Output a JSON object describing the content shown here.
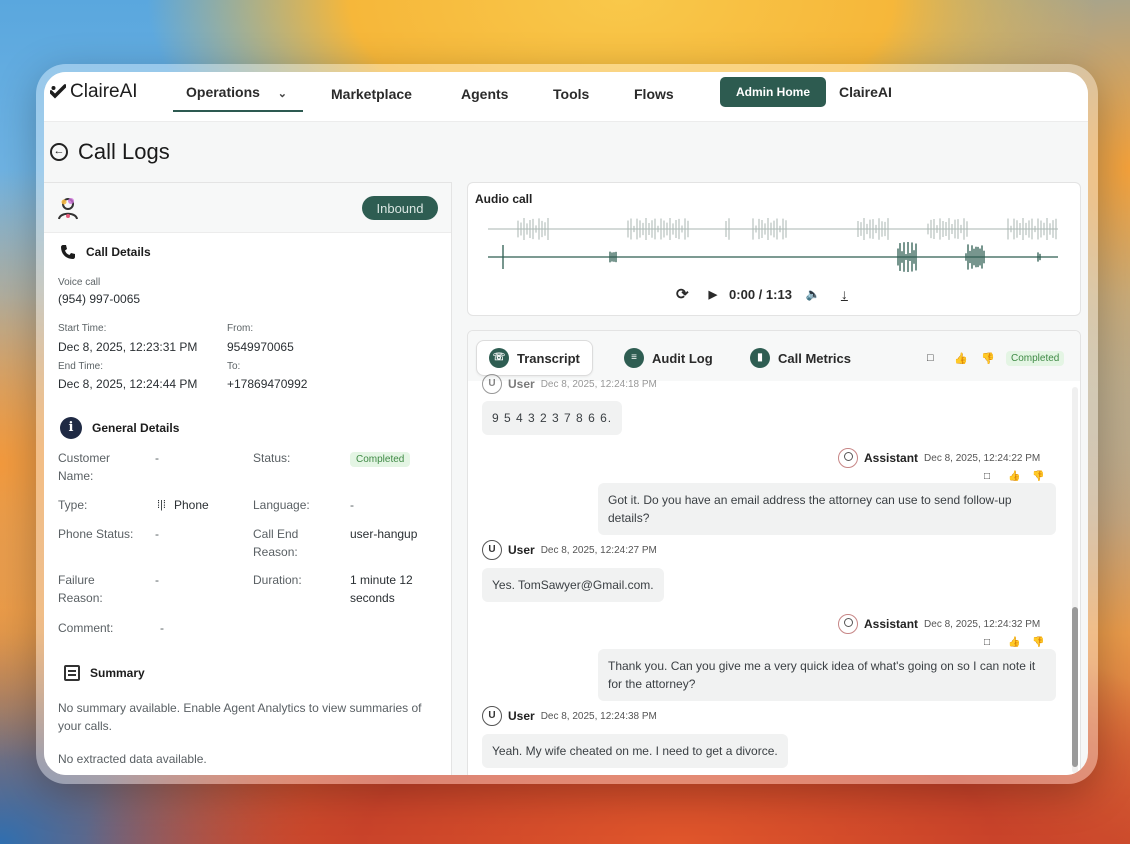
{
  "nav": {
    "logo": "ClaireAI",
    "operations": "Operations",
    "marketplace": "Marketplace",
    "agents": "Agents",
    "tools": "Tools",
    "flows": "Flows",
    "admin_home": "Admin Home",
    "account": "ClaireAI"
  },
  "page": {
    "title": "Call Logs"
  },
  "left": {
    "badge": "Inbound",
    "call_details": {
      "title": "Call Details",
      "call_type": "Voice call",
      "phone": "(954) 997-0065",
      "start_label": "Start Time:",
      "start_value": "Dec 8, 2025, 12:23:31 PM",
      "from_label": "From:",
      "from_value": "9549970065",
      "end_label": "End Time:",
      "end_value": "Dec 8, 2025, 12:24:44 PM",
      "to_label": "To:",
      "to_value": "+17869470992"
    },
    "general": {
      "title": "General Details",
      "customer_name_label": "Customer Name:",
      "customer_name_value": "-",
      "status_label": "Status:",
      "status_value": "Completed",
      "type_label": "Type:",
      "type_value": "Phone",
      "language_label": "Language:",
      "language_value": "-",
      "phone_status_label": "Phone Status:",
      "phone_status_value": "-",
      "end_reason_label": "Call End Reason:",
      "end_reason_value": "user-hangup",
      "failure_label": "Failure Reason:",
      "failure_value": "-",
      "duration_label": "Duration:",
      "duration_value": "1 minute 12 seconds",
      "comment_label": "Comment:",
      "comment_value": "-"
    },
    "summary": {
      "title": "Summary",
      "text": "No summary available. Enable Agent Analytics to view summaries of your calls.",
      "extracted": "No extracted data available."
    }
  },
  "audio": {
    "title": "Audio call",
    "time": "0:00 / 1:13",
    "accent": "#2e5d52"
  },
  "transcript": {
    "tabs": [
      "Transcript",
      "Audit Log",
      "Call Metrics"
    ],
    "status": "Completed",
    "messages": [
      {
        "role": "User",
        "time": "Dec 8, 2025, 12:24:18 PM",
        "text": "9 5 4 3 2 3 7 8 6 6."
      },
      {
        "role": "Assistant",
        "time": "Dec 8, 2025, 12:24:22 PM",
        "text": "Got it. Do you have an email address the attorney can use to send follow-up details?"
      },
      {
        "role": "User",
        "time": "Dec 8, 2025, 12:24:27 PM",
        "text": "Yes. TomSawyer@Gmail.com."
      },
      {
        "role": "Assistant",
        "time": "Dec 8, 2025, 12:24:32 PM",
        "text": "Thank you. Can you give me a very quick idea of what's going on so I can note it for the attorney?"
      },
      {
        "role": "User",
        "time": "Dec 8, 2025, 12:24:38 PM",
        "text": "Yeah. My wife cheated on me. I need to get a divorce."
      }
    ]
  }
}
